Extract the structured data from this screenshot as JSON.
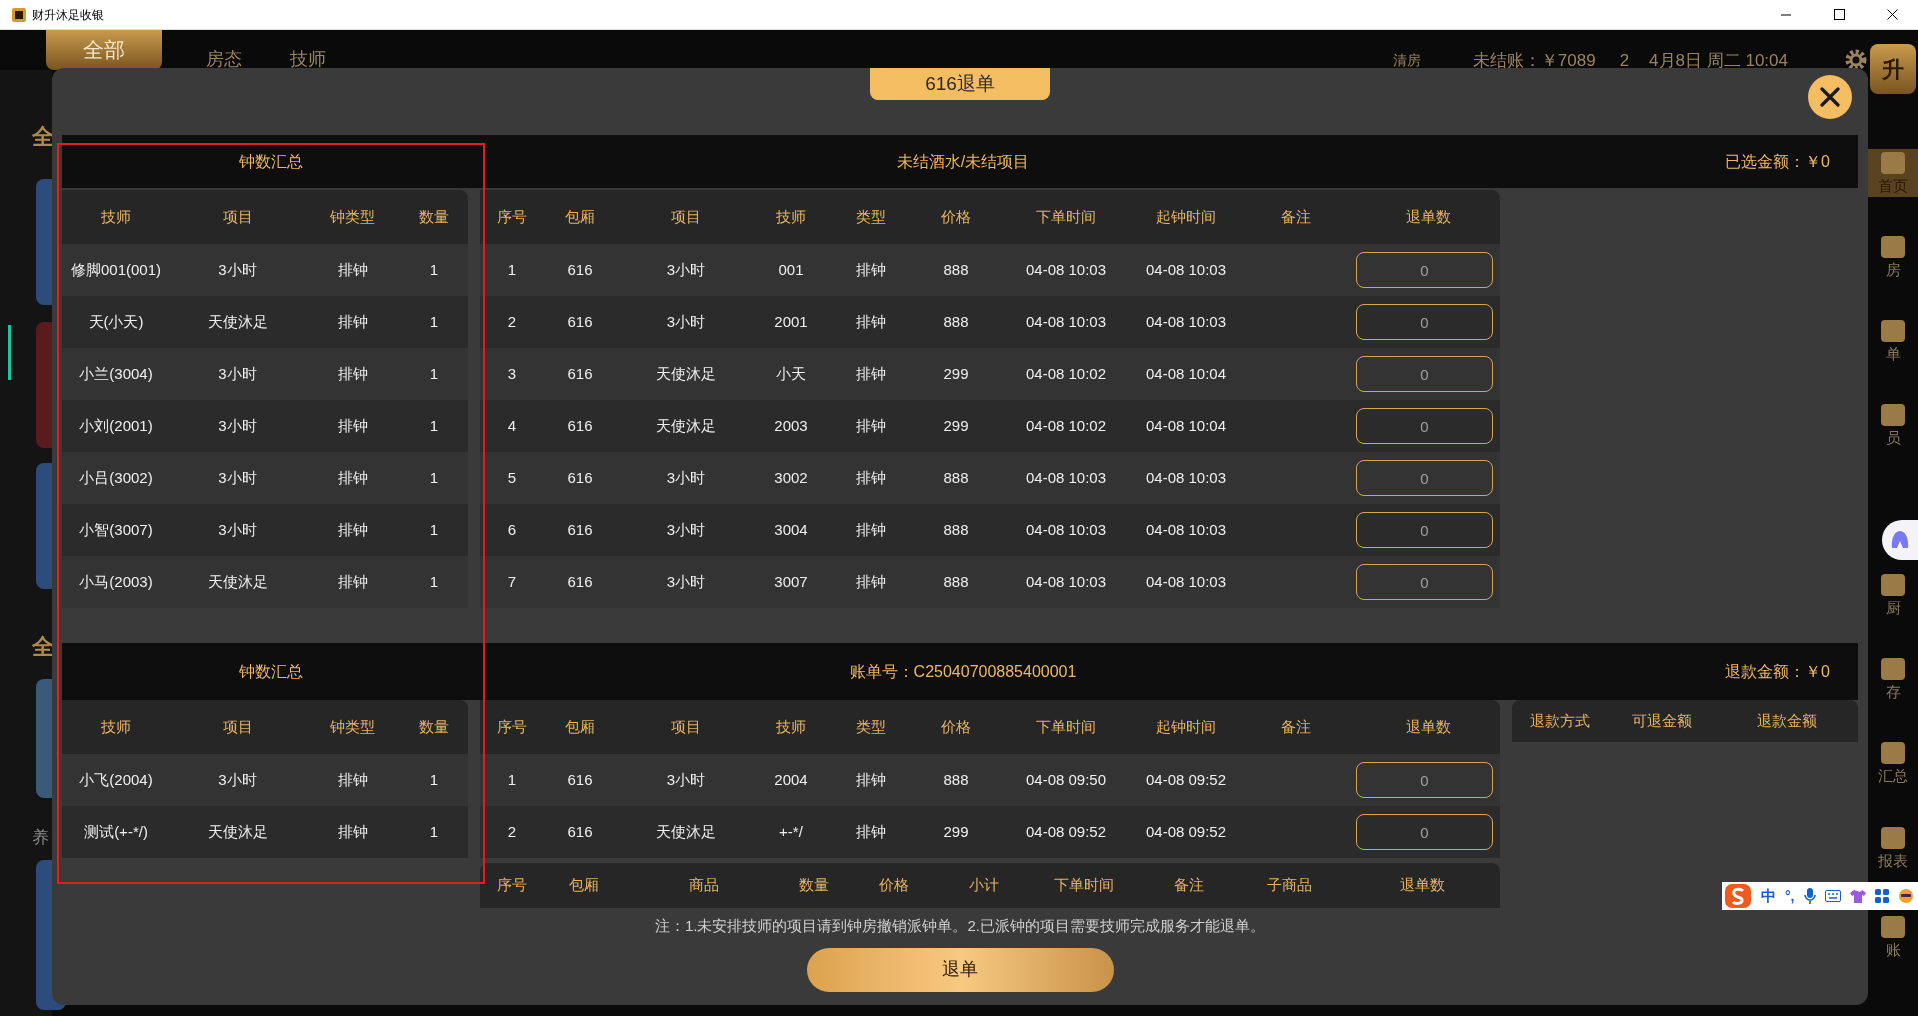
{
  "window": {
    "title": "财升沐足收银"
  },
  "app_bar": {
    "tabs": [
      {
        "label": "全部",
        "selected": true
      },
      {
        "label": "房态",
        "selected": false
      },
      {
        "label": "技师",
        "selected": false
      }
    ],
    "clean_room": "清房",
    "unpaid": "未结账：￥7089",
    "count": "2",
    "datetime": "4月8日 周二 10:04",
    "logo": "升"
  },
  "left_strip": {
    "labels": [
      "全",
      "全",
      "养"
    ]
  },
  "side_nav": [
    {
      "label": "首页",
      "selected": true
    },
    {
      "label": "房",
      "selected": false
    },
    {
      "label": "单",
      "selected": false
    },
    {
      "label": "员",
      "selected": false
    },
    {
      "label": "厨",
      "selected": false
    },
    {
      "label": "存",
      "selected": false
    },
    {
      "label": "汇总",
      "selected": false
    },
    {
      "label": "报表",
      "selected": false
    },
    {
      "label": "账",
      "selected": false
    }
  ],
  "dialog": {
    "title": "616退单",
    "clock_summaries": [
      {
        "title": "钟数汇总",
        "columns": [
          "技师",
          "项目",
          "钟类型",
          "数量"
        ],
        "rows": [
          [
            "修脚001(001)",
            "3小时",
            "排钟",
            "1"
          ],
          [
            "天(小天)",
            "天使沐足",
            "排钟",
            "1"
          ],
          [
            "小兰(3004)",
            "3小时",
            "排钟",
            "1"
          ],
          [
            "小刘(2001)",
            "3小时",
            "排钟",
            "1"
          ],
          [
            "小吕(3002)",
            "3小时",
            "排钟",
            "1"
          ],
          [
            "小智(3007)",
            "3小时",
            "排钟",
            "1"
          ],
          [
            "小马(2003)",
            "天使沐足",
            "排钟",
            "1"
          ]
        ]
      },
      {
        "title": "钟数汇总",
        "columns": [
          "技师",
          "项目",
          "钟类型",
          "数量"
        ],
        "rows": [
          [
            "小飞(2004)",
            "3小时",
            "排钟",
            "1"
          ],
          [
            "测试(+-*/)",
            "天使沐足",
            "排钟",
            "1"
          ]
        ]
      }
    ],
    "unsettled": {
      "title": "未结酒水/未结项目",
      "selected_amount": "已选金额：￥0",
      "columns": [
        "序号",
        "包厢",
        "项目",
        "技师",
        "类型",
        "价格",
        "下单时间",
        "起钟时间",
        "备注",
        "退单数"
      ],
      "rows": [
        {
          "cells": [
            "1",
            "616",
            "3小时",
            "001",
            "排钟",
            "888",
            "04-08 10:03",
            "04-08 10:03"
          ],
          "refund_qty": "0"
        },
        {
          "cells": [
            "2",
            "616",
            "3小时",
            "2001",
            "排钟",
            "888",
            "04-08 10:03",
            "04-08 10:03"
          ],
          "refund_qty": "0"
        },
        {
          "cells": [
            "3",
            "616",
            "天使沐足",
            "小天",
            "排钟",
            "299",
            "04-08 10:02",
            "04-08 10:04"
          ],
          "refund_qty": "0"
        },
        {
          "cells": [
            "4",
            "616",
            "天使沐足",
            "2003",
            "排钟",
            "299",
            "04-08 10:02",
            "04-08 10:04"
          ],
          "refund_qty": "0"
        },
        {
          "cells": [
            "5",
            "616",
            "3小时",
            "3002",
            "排钟",
            "888",
            "04-08 10:03",
            "04-08 10:03"
          ],
          "refund_qty": "0"
        },
        {
          "cells": [
            "6",
            "616",
            "3小时",
            "3004",
            "排钟",
            "888",
            "04-08 10:03",
            "04-08 10:03"
          ],
          "refund_qty": "0"
        },
        {
          "cells": [
            "7",
            "616",
            "3小时",
            "3007",
            "排钟",
            "888",
            "04-08 10:03",
            "04-08 10:03"
          ],
          "refund_qty": "0"
        }
      ]
    },
    "bill": {
      "title": "账单号：C25040700885400001",
      "refund_amount": "退款金额：￥0",
      "columns": [
        "序号",
        "包厢",
        "项目",
        "技师",
        "类型",
        "价格",
        "下单时间",
        "起钟时间",
        "备注",
        "退单数"
      ],
      "rows": [
        {
          "cells": [
            "1",
            "616",
            "3小时",
            "2004",
            "排钟",
            "888",
            "04-08 09:50",
            "04-08 09:52"
          ],
          "refund_qty": "0"
        },
        {
          "cells": [
            "2",
            "616",
            "天使沐足",
            "+-*/",
            "排钟",
            "299",
            "04-08 09:52",
            "04-08 09:52"
          ],
          "refund_qty": "0"
        }
      ]
    },
    "refund_methods": {
      "columns": [
        "退款方式",
        "可退金额",
        "退款金额"
      ]
    },
    "goods": {
      "columns": [
        "序号",
        "包厢",
        "商品",
        "数量",
        "价格",
        "小计",
        "下单时间",
        "备注",
        "子商品",
        "退单数"
      ]
    },
    "note": "注：1.未安排技师的项目请到钟房撤销派钟单。2.已派钟的项目需要技师完成服务才能退单。",
    "submit": "退单"
  },
  "ime_toolbar": {
    "mode": "中",
    "punctuation": "°,"
  }
}
